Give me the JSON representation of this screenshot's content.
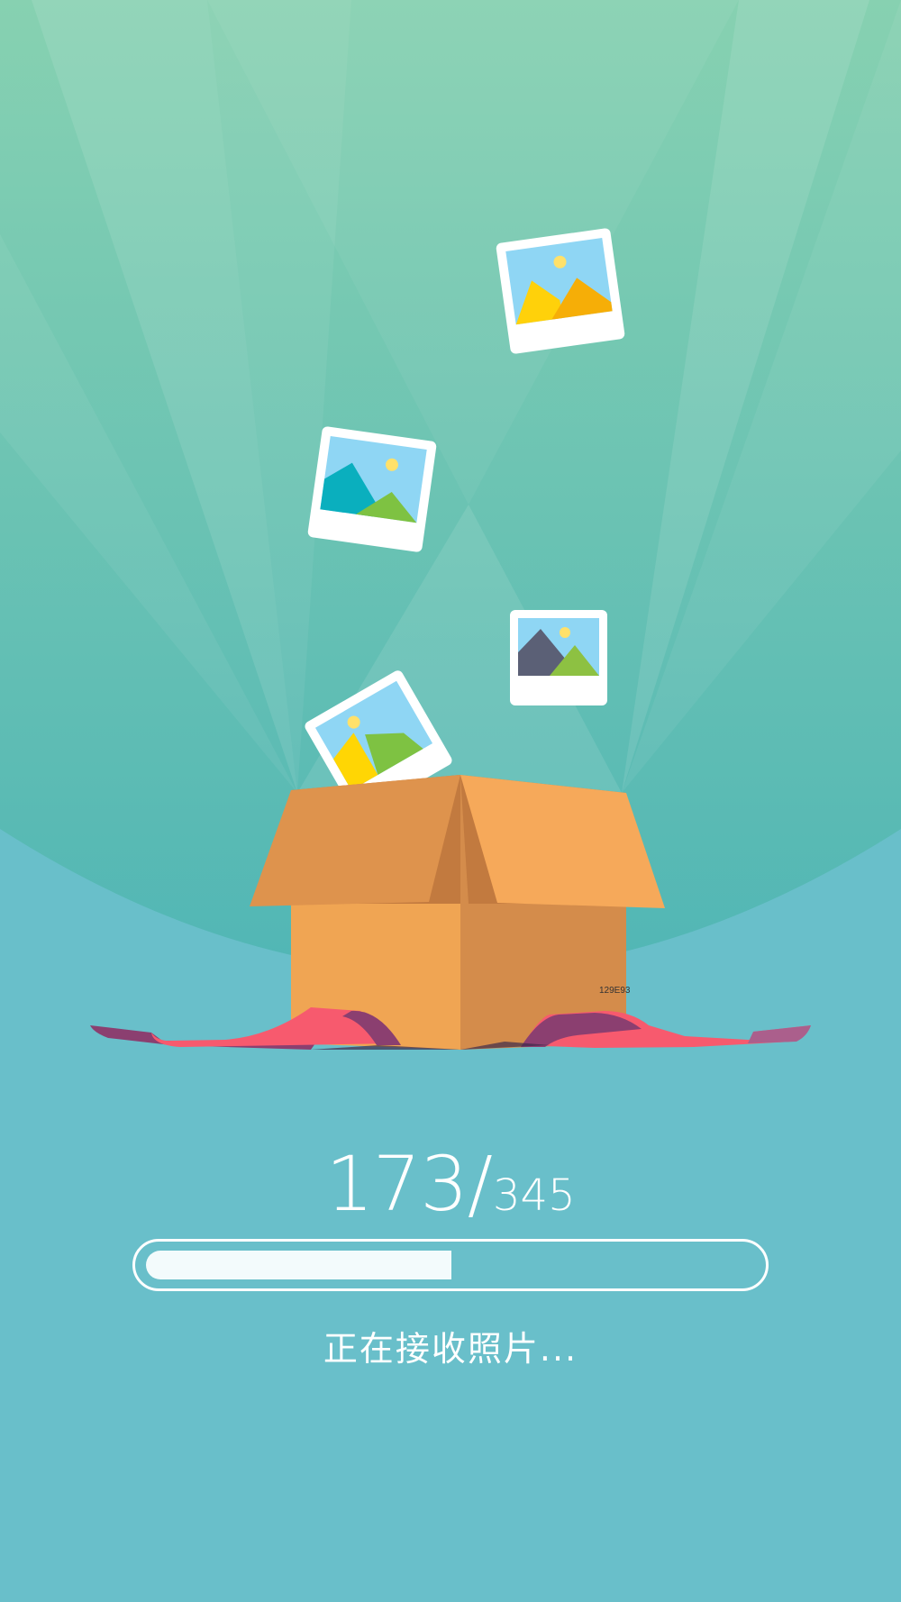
{
  "progress": {
    "current": "173",
    "separator": "/",
    "total": "345",
    "fraction": 0.501
  },
  "status_text": "正在接收照片...",
  "box_code": "129E93",
  "colors": {
    "sky_top": "#85d0b2",
    "hill": "#55b8b3",
    "background": "#69bfca",
    "box_front": "#f0a553",
    "box_side": "#d48c4b",
    "ribbon_pink": "#f75a6e",
    "ribbon_purple": "#8b3f70",
    "progress_fill": "#f3fbfc"
  },
  "icons": [
    "photo-icon-falling-top",
    "photo-icon-falling-left",
    "photo-icon-falling-right",
    "photo-icon-in-box",
    "gift-box-icon",
    "ribbon-icon"
  ]
}
